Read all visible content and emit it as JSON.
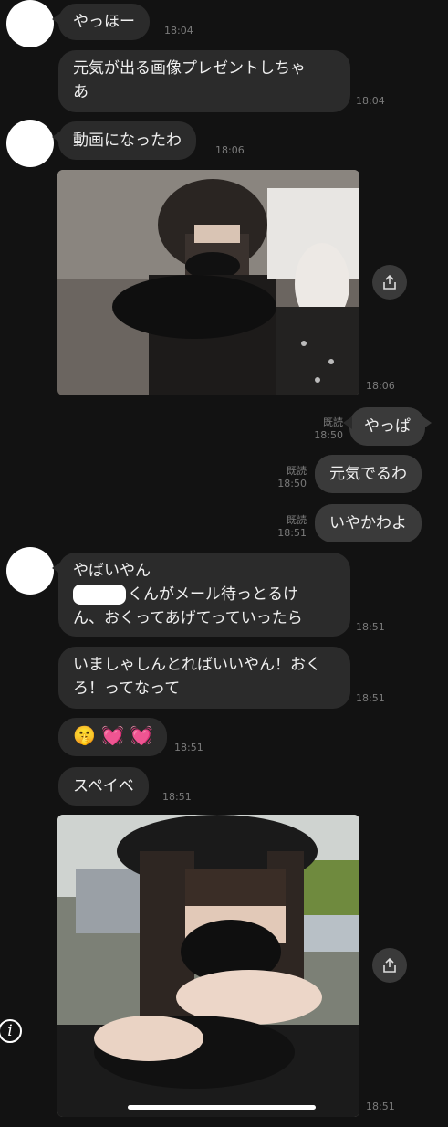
{
  "messages": {
    "m1": {
      "text": "やっほー",
      "time": "18:04"
    },
    "m2": {
      "text": "元気が出る画像プレゼントしちゃ\nあ",
      "time": "18:04"
    },
    "m3": {
      "text": "動画になったわ",
      "time": "18:06"
    },
    "m4": {
      "time": "18:06"
    },
    "o1": {
      "text": "やっぱ",
      "read": "既読",
      "time": "18:50"
    },
    "o2": {
      "text": "元気でるわ",
      "read": "既読",
      "time": "18:50"
    },
    "o3": {
      "text": "いやかわよ",
      "read": "既読",
      "time": "18:51"
    },
    "m5": {
      "line1": "やばいやん",
      "line2": "くんがメール待っとるけ",
      "line3": "ん、おくってあげてっていったら",
      "time": "18:51"
    },
    "m6": {
      "text": "いましゃしんとればいいやん！おく\nろ！ってなって",
      "time": "18:51"
    },
    "m7": {
      "emoji": "🤫 💓 💓",
      "time": "18:51"
    },
    "m8": {
      "text": "スペイベ",
      "time": "18:51"
    },
    "m9": {
      "time": "18:51"
    }
  },
  "icons": {
    "share": "share-icon",
    "info": "info-icon"
  },
  "info_label": "i"
}
